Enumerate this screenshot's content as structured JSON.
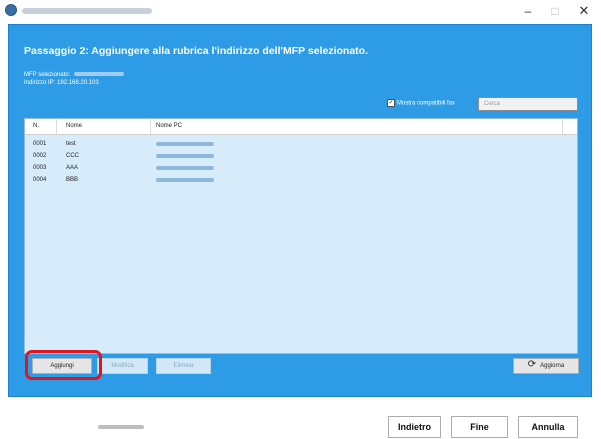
{
  "window": {
    "min_label": "–",
    "max_label": "□",
    "close_label": "✕"
  },
  "header": {
    "title": "Passaggio 2: Aggiungere alla rubrica l'indirizzo dell'MFP selezionato.",
    "mfp_label": "MFP selezionato:",
    "ip_label": "Indirizzo IP: 192.168.20.103"
  },
  "filter": {
    "checkbox_label": "Mostra compatibili fax",
    "checked": true,
    "check_mark": "✓",
    "search_placeholder": "Cerca"
  },
  "table": {
    "columns": [
      "N.",
      "Nome",
      "Nome PC"
    ],
    "rows": [
      {
        "num": "0001",
        "name": "test"
      },
      {
        "num": "0002",
        "name": "CCC"
      },
      {
        "num": "0003",
        "name": "AAA"
      },
      {
        "num": "0004",
        "name": "BBB"
      }
    ]
  },
  "actions": {
    "add": "Aggiungi",
    "edit": "Modifica",
    "delete": "Elimina",
    "refresh": "Aggiorna",
    "refresh_icon": "⟳"
  },
  "footer": {
    "back": "Indietro",
    "finish": "Fine",
    "cancel": "Annulla"
  },
  "colors": {
    "panel": "#2e9be6",
    "list": "#d6ecfb",
    "highlight": "#e0151d"
  }
}
